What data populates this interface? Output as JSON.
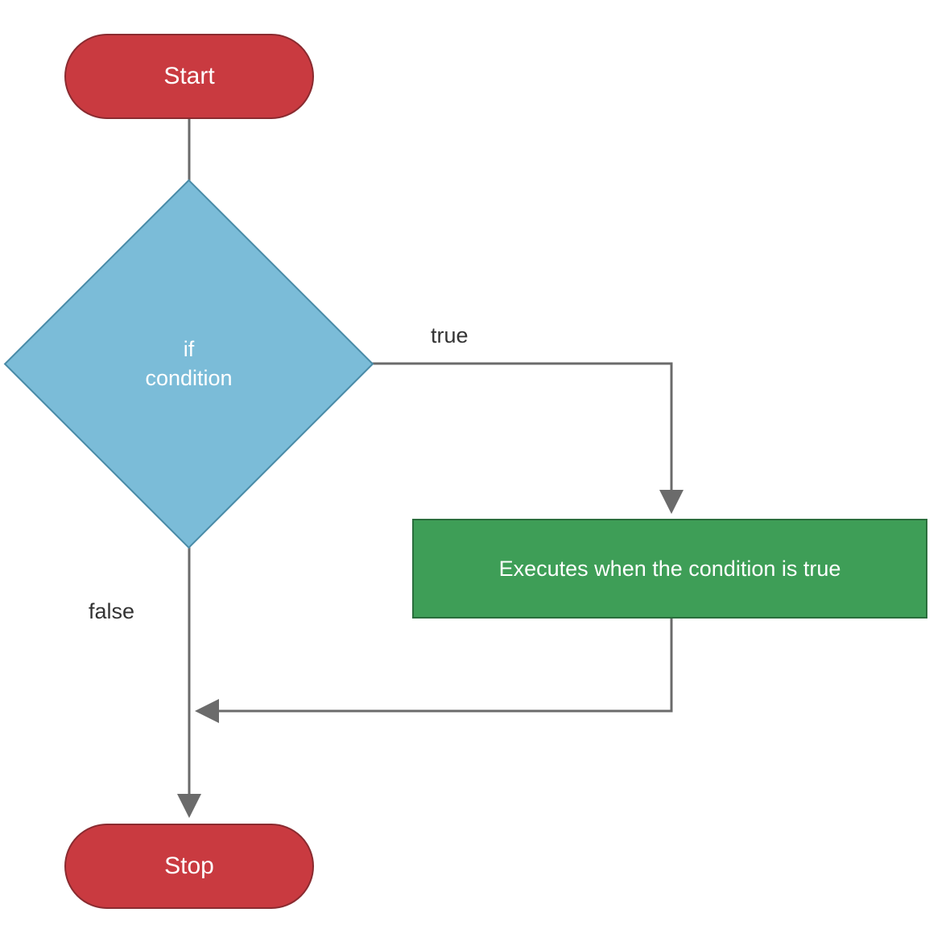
{
  "nodes": {
    "start": {
      "label": "Start",
      "type": "terminator",
      "color": "#c93a40"
    },
    "decision": {
      "label_line1": "if",
      "label_line2": "condition",
      "type": "decision",
      "color": "#7bbcd8"
    },
    "process": {
      "label": "Executes when the condition is true",
      "type": "process",
      "color": "#3e9e57"
    },
    "stop": {
      "label": "Stop",
      "type": "terminator",
      "color": "#c93a40"
    }
  },
  "edges": {
    "true_label": "true",
    "false_label": "false"
  },
  "diagram": {
    "type": "flowchart",
    "description": "if-statement control flow",
    "flow": [
      {
        "from": "start",
        "to": "decision"
      },
      {
        "from": "decision",
        "to": "process",
        "condition": "true"
      },
      {
        "from": "decision",
        "to": "stop",
        "condition": "false"
      },
      {
        "from": "process",
        "to": "stop"
      }
    ]
  }
}
